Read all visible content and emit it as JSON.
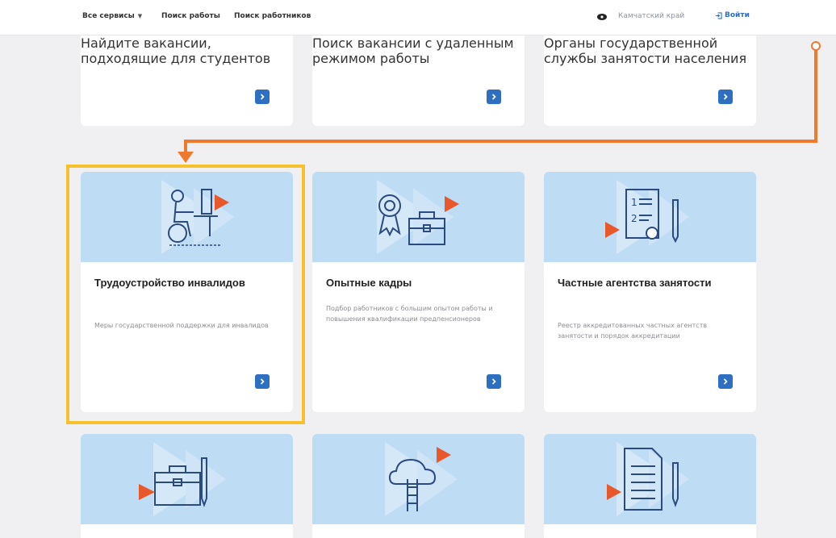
{
  "header": {
    "services_label": "Все сервисы",
    "jobs_label": "Поиск работы",
    "workers_label": "Поиск работников",
    "region": "Камчатский край",
    "login_label": "Войти"
  },
  "top_cards": [
    {
      "desc": "Найдите вакансии, подходящие для студентов"
    },
    {
      "desc": "Поиск вакансии с удаленным режимом работы"
    },
    {
      "desc": "Органы государственной службы занятости населения"
    }
  ],
  "cards": [
    {
      "title": "Трудоустройство инвалидов",
      "desc": "Меры государственной поддержки для инвалидов",
      "icon": "wheelchair-worker-icon"
    },
    {
      "title": "Опытные кадры",
      "desc": "Подбор работников с большим опытом работы и повышения квалификации предпенсионеров",
      "icon": "award-briefcase-icon"
    },
    {
      "title": "Частные агентства занятости",
      "desc": "Реестр аккредитованных частных агентств занятости и порядок аккредитации",
      "icon": "certificate-document-icon"
    }
  ],
  "bottom_cards": [
    {
      "icon": "briefcase-pen-icon"
    },
    {
      "icon": "cloud-ladder-icon"
    },
    {
      "icon": "document-pen-icon"
    }
  ],
  "colors": {
    "accent": "#2f6fc1",
    "banner": "#bfdcf5",
    "highlight": "#f6c12b",
    "connector": "#ef7a2e",
    "play": "#e8582a"
  }
}
